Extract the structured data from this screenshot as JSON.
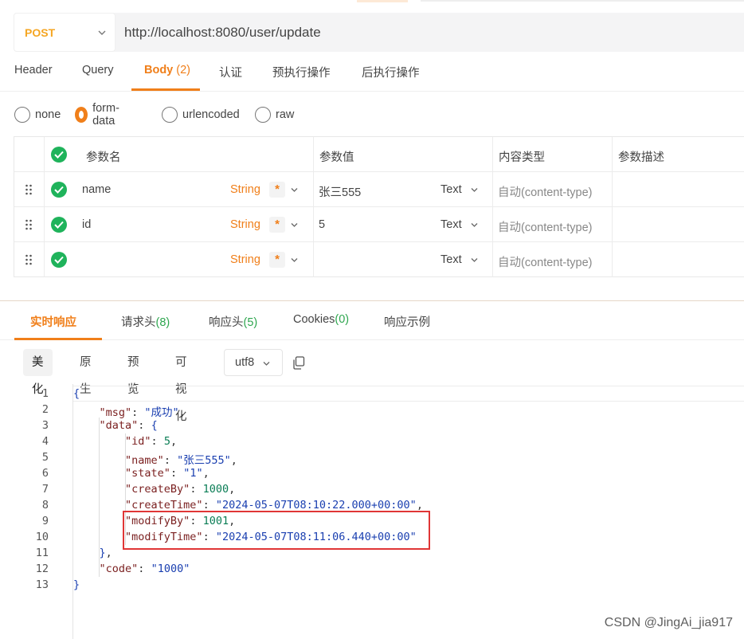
{
  "request": {
    "method": "POST",
    "url": "http://localhost:8080/user/update",
    "tabs": [
      {
        "label": "Header",
        "count": ""
      },
      {
        "label": "Query",
        "count": ""
      },
      {
        "label": "Body",
        "count": "(2)"
      },
      {
        "label": "认证",
        "count": ""
      },
      {
        "label": "预执行操作",
        "count": ""
      },
      {
        "label": "后执行操作",
        "count": ""
      }
    ],
    "active_tab": "Body"
  },
  "body_types": [
    "none",
    "form-data",
    "urlencoded",
    "raw"
  ],
  "selected_body_type": "form-data",
  "params": {
    "headers": [
      "参数名",
      "参数值",
      "内容类型",
      "参数描述"
    ],
    "rows": [
      {
        "name": "name",
        "type": "String",
        "required": "*",
        "value": "张三555",
        "value_type": "Text",
        "content_type": "自动(content-type)"
      },
      {
        "name": "id",
        "type": "String",
        "required": "*",
        "value": "5",
        "value_type": "Text",
        "content_type": "自动(content-type)"
      },
      {
        "name": "",
        "type": "String",
        "required": "*",
        "value": "",
        "value_type": "Text",
        "content_type": "自动(content-type)"
      }
    ]
  },
  "response": {
    "tabs": [
      {
        "label": "实时响应",
        "count": ""
      },
      {
        "label": "请求头",
        "count": "(8)"
      },
      {
        "label": "响应头",
        "count": "(5)"
      },
      {
        "label": "Cookies",
        "count": "(0)"
      },
      {
        "label": "响应示例",
        "count": ""
      }
    ],
    "active_tab": "实时响应",
    "views": [
      "美化",
      "原生",
      "预览",
      "可视化"
    ],
    "active_view": "美化",
    "encoding": "utf8",
    "lines": [
      {
        "n": "1",
        "indent": "",
        "parts": [
          [
            "p",
            "{"
          ]
        ]
      },
      {
        "n": "2",
        "indent": "    ",
        "parts": [
          [
            "k",
            "\"msg\""
          ],
          [
            "o",
            ": "
          ],
          [
            "s",
            "\"成功\""
          ],
          [
            "o",
            ","
          ]
        ]
      },
      {
        "n": "3",
        "indent": "    ",
        "parts": [
          [
            "k",
            "\"data\""
          ],
          [
            "o",
            ": "
          ],
          [
            "p",
            "{"
          ]
        ]
      },
      {
        "n": "4",
        "indent": "        ",
        "parts": [
          [
            "k",
            "\"id\""
          ],
          [
            "o",
            ": "
          ],
          [
            "n",
            "5"
          ],
          [
            "o",
            ","
          ]
        ]
      },
      {
        "n": "5",
        "indent": "        ",
        "parts": [
          [
            "k",
            "\"name\""
          ],
          [
            "o",
            ": "
          ],
          [
            "s",
            "\"张三555\""
          ],
          [
            "o",
            ","
          ]
        ]
      },
      {
        "n": "6",
        "indent": "        ",
        "parts": [
          [
            "k",
            "\"state\""
          ],
          [
            "o",
            ": "
          ],
          [
            "s",
            "\"1\""
          ],
          [
            "o",
            ","
          ]
        ]
      },
      {
        "n": "7",
        "indent": "        ",
        "parts": [
          [
            "k",
            "\"createBy\""
          ],
          [
            "o",
            ": "
          ],
          [
            "n",
            "1000"
          ],
          [
            "o",
            ","
          ]
        ]
      },
      {
        "n": "8",
        "indent": "        ",
        "parts": [
          [
            "k",
            "\"createTime\""
          ],
          [
            "o",
            ": "
          ],
          [
            "s",
            "\"2024-05-07T08:10:22.000+00:00\""
          ],
          [
            "o",
            ","
          ]
        ]
      },
      {
        "n": "9",
        "indent": "        ",
        "parts": [
          [
            "k",
            "\"modifyBy\""
          ],
          [
            "o",
            ": "
          ],
          [
            "n",
            "1001"
          ],
          [
            "o",
            ","
          ]
        ]
      },
      {
        "n": "10",
        "indent": "        ",
        "parts": [
          [
            "k",
            "\"modifyTime\""
          ],
          [
            "o",
            ": "
          ],
          [
            "s",
            "\"2024-05-07T08:11:06.440+00:00\""
          ]
        ]
      },
      {
        "n": "11",
        "indent": "    ",
        "parts": [
          [
            "p",
            "}"
          ],
          [
            "o",
            ","
          ]
        ]
      },
      {
        "n": "12",
        "indent": "    ",
        "parts": [
          [
            "k",
            "\"code\""
          ],
          [
            "o",
            ": "
          ],
          [
            "s",
            "\"1000\""
          ]
        ]
      },
      {
        "n": "13",
        "indent": "",
        "parts": [
          [
            "p",
            "}"
          ]
        ]
      }
    ]
  },
  "watermark": "CSDN @JingAi_jia917",
  "colors": {
    "accent": "#f07f1a",
    "method": "#f5a623",
    "check": "#1fb35b",
    "highlight": "#e03636"
  },
  "icons": [
    "chevron-down-icon",
    "check-circle-icon",
    "drag-handle-icon",
    "copy-icon"
  ]
}
